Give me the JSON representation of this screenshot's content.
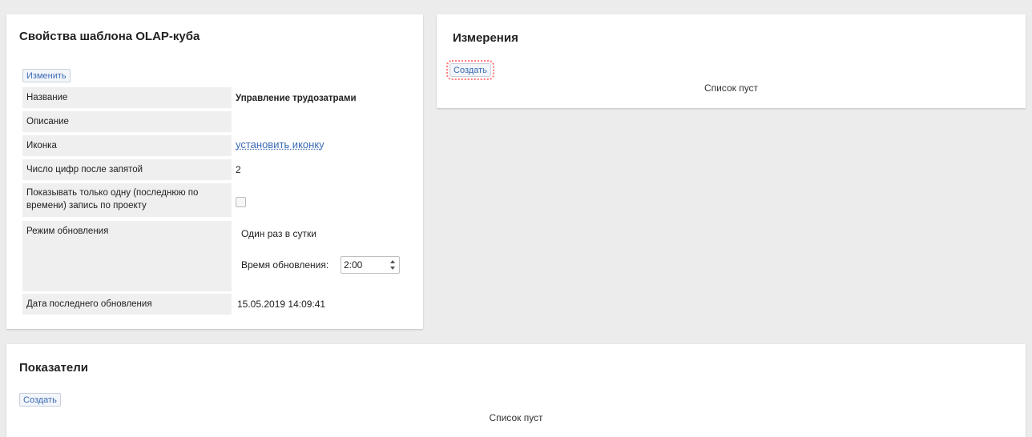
{
  "properties_panel": {
    "title": "Свойства шаблона OLAP-куба",
    "edit_button": "Изменить",
    "rows": {
      "name": {
        "label": "Название",
        "value": "Управление трудозатрами"
      },
      "description": {
        "label": "Описание",
        "value": ""
      },
      "icon": {
        "label": "Иконка",
        "value": "установить иконку"
      },
      "decimals": {
        "label": "Число цифр после запятой",
        "value": "2"
      },
      "show_last": {
        "label": "Показывать только одну (последнюю по времени) запись по проекту",
        "checked": false
      },
      "update_mode": {
        "label": "Режим обновления",
        "value": "Один раз в сутки",
        "time_label": "Время обновления:",
        "time_value": "2:00"
      },
      "last_update": {
        "label": "Дата последнего обновления",
        "value": "15.05.2019 14:09:41"
      }
    }
  },
  "dimensions_panel": {
    "title": "Измерения",
    "create_button": "Создать",
    "empty_text": "Список пуст"
  },
  "measures_panel": {
    "title": "Показатели",
    "create_button": "Создать",
    "empty_text": "Список пуст"
  },
  "colors": {
    "accent": "#3b6bb5",
    "focus_outline": "#ff7a7a",
    "background": "#ececec"
  }
}
